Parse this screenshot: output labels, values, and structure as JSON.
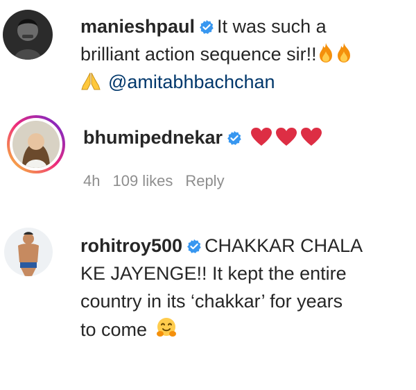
{
  "comments": [
    {
      "username": "manieshpaul",
      "verified": true,
      "line1": "It was such a",
      "line2": "brilliant action sequence sir!!",
      "mention": "@amitabhbachchan",
      "emojis": [
        "fire-icon",
        "fire-icon",
        "folded-hands-icon"
      ]
    },
    {
      "username": "bhumipednekar",
      "verified": true,
      "emojis": [
        "red-heart-icon",
        "red-heart-icon",
        "red-heart-icon"
      ],
      "time": "4h",
      "likes": "109 likes",
      "reply": "Reply"
    },
    {
      "username": "rohitroy500",
      "verified": true,
      "line1": "CHAKKAR CHALA",
      "line2": "KE JAYENGE!! It kept the entire",
      "line3": "country in its ‘chakkar’ for years",
      "line4": "to come",
      "emojis": [
        "hugging-face-icon"
      ]
    }
  ],
  "colors": {
    "verified": "#3897f0",
    "text": "#262626",
    "meta": "#8e8e8e",
    "mention": "#00376b",
    "story_ring_start": "#f9ce34",
    "story_ring_end": "#ee2a7b"
  }
}
